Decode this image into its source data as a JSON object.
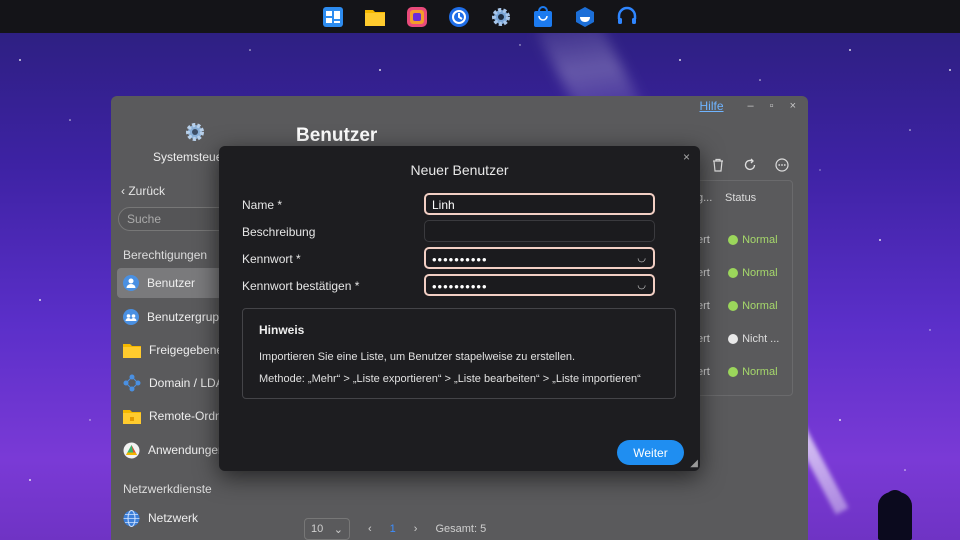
{
  "taskbar": {
    "icons": [
      "control-panel-icon",
      "file-manager-icon",
      "photo-app-icon",
      "backup-clock-icon",
      "settings-gear-icon",
      "package-center-icon",
      "docker-icon",
      "support-headset-icon"
    ]
  },
  "window": {
    "help_label": "Hilfe",
    "minimize_glyph": "–",
    "maximize_glyph": "▫",
    "close_glyph": "×",
    "sidebar": {
      "app_title": "Systemsteuer",
      "back_label": "Zurück",
      "search_placeholder": "Suche",
      "section_permissions": "Berechtigungen",
      "section_network": "Netzwerkdienste",
      "items": [
        {
          "label": "Benutzer",
          "icon": "user-icon",
          "active": true
        },
        {
          "label": "Benutzergrupp",
          "icon": "user-group-icon"
        },
        {
          "label": "Freigegebene",
          "icon": "folder-icon"
        },
        {
          "label": "Domain / LDAP",
          "icon": "domain-icon"
        },
        {
          "label": "Remote-Ordne",
          "icon": "remote-folder-icon"
        },
        {
          "label": "Anwendungen",
          "icon": "applications-icon"
        },
        {
          "label": "Netzwerk",
          "icon": "network-globe-icon"
        }
      ]
    },
    "main": {
      "title": "Benutzer",
      "columns": {
        "truncated": "g...",
        "status": "Status"
      },
      "rows": [
        {
          "left": "ert",
          "status": "Normal",
          "kind": "ok"
        },
        {
          "left": "ert",
          "status": "Normal",
          "kind": "ok"
        },
        {
          "left": "ert",
          "status": "Normal",
          "kind": "ok"
        },
        {
          "left": "ert",
          "status": "Nicht ...",
          "kind": "disabled"
        },
        {
          "left": "ert",
          "status": "Normal",
          "kind": "ok"
        }
      ]
    },
    "pager": {
      "page_size": "10",
      "prev_glyph": "‹",
      "current_page": "1",
      "next_glyph": "›",
      "total": "Gesamt: 5"
    }
  },
  "modal": {
    "title": "Neuer Benutzer",
    "close_glyph": "×",
    "fields": {
      "name_label": "Name *",
      "name_value": "Linh",
      "description_label": "Beschreibung",
      "description_value": "",
      "password_label": "Kennwort *",
      "password_value": "••••••••••",
      "confirm_label": "Kennwort bestätigen *",
      "confirm_value": "••••••••••"
    },
    "hint": {
      "title": "Hinweis",
      "line1": "Importieren Sie eine Liste, um Benutzer stapelweise zu erstellen.",
      "line2": "Methode: „Mehr“ > „Liste exportieren“ > „Liste bearbeiten“ > „Liste importieren“"
    },
    "next_label": "Weiter"
  },
  "colors": {
    "accent": "#1f8ef1",
    "status_ok": "#9bd65b",
    "focus_border": "#f2cfc4"
  }
}
